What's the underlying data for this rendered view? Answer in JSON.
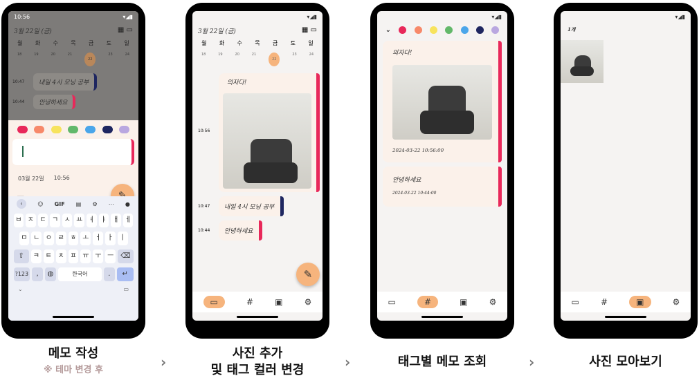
{
  "palette": [
    "#e8285a",
    "#f7896a",
    "#f7e35d",
    "#62b86a",
    "#4aa6ea",
    "#1e2660",
    "#b9a7e0"
  ],
  "screens": {
    "s1": {
      "status_time": "10:56",
      "date_header": "3월 22일 (금)",
      "weekdays": [
        "월",
        "화",
        "수",
        "목",
        "금",
        "토",
        "일"
      ],
      "days": [
        "18",
        "19",
        "20",
        "21",
        "22",
        "23",
        "24"
      ],
      "memo1_time": "10:47",
      "memo1_text": "내일 4시 모닝 공부",
      "memo2_time": "10:44",
      "memo2_text": "안녕하세요",
      "editor_date": "03월 22일",
      "editor_time": "10:56",
      "kb_toolbar": [
        "GIF"
      ],
      "kb_row1": [
        "ㅂ",
        "ㅈ",
        "ㄷ",
        "ㄱ",
        "ㅅ",
        "ㅛ",
        "ㅕ",
        "ㅑ",
        "ㅐ",
        "ㅔ"
      ],
      "kb_row1_nums": [
        "1",
        "2",
        "3",
        "4",
        "5",
        "6",
        "7",
        "8",
        "9",
        "0"
      ],
      "kb_row2": [
        "ㅁ",
        "ㄴ",
        "ㅇ",
        "ㄹ",
        "ㅎ",
        "ㅗ",
        "ㅓ",
        "ㅏ",
        "ㅣ"
      ],
      "kb_row3": [
        "ㅋ",
        "ㅌ",
        "ㅊ",
        "ㅍ",
        "ㅠ",
        "ㅜ",
        "ㅡ"
      ],
      "kb_mode": "?123",
      "kb_space": "한국어",
      "kb_period": "."
    },
    "s2": {
      "date_header": "3월 22일 (금)",
      "weekdays": [
        "월",
        "화",
        "수",
        "목",
        "금",
        "토",
        "일"
      ],
      "days": [
        "18",
        "19",
        "20",
        "21",
        "22",
        "23",
        "24"
      ],
      "photo_memo_time": "10:56",
      "photo_memo_text": "의자다!",
      "memo1_time": "10:47",
      "memo1_text": "내일 4시 모닝 공부",
      "memo2_time": "10:44",
      "memo2_text": "안녕하세요"
    },
    "s3": {
      "card1_text": "의자다!",
      "card1_stamp": "2024-03-22 10:56:00",
      "card2_text": "안녕하세요",
      "card2_stamp": "2024-03-22 10:44:00"
    },
    "s4": {
      "count_label": "1개"
    }
  },
  "captions": {
    "c1_title": "메모 작성",
    "c1_sub": "※ 테마 변경 후",
    "c2_line1": "사진 추가",
    "c2_line2": "및 태그 컬러 변경",
    "c3_title": "태그별 메모 조회",
    "c4_title": "사진 모아보기"
  },
  "arrow_glyph": "›"
}
